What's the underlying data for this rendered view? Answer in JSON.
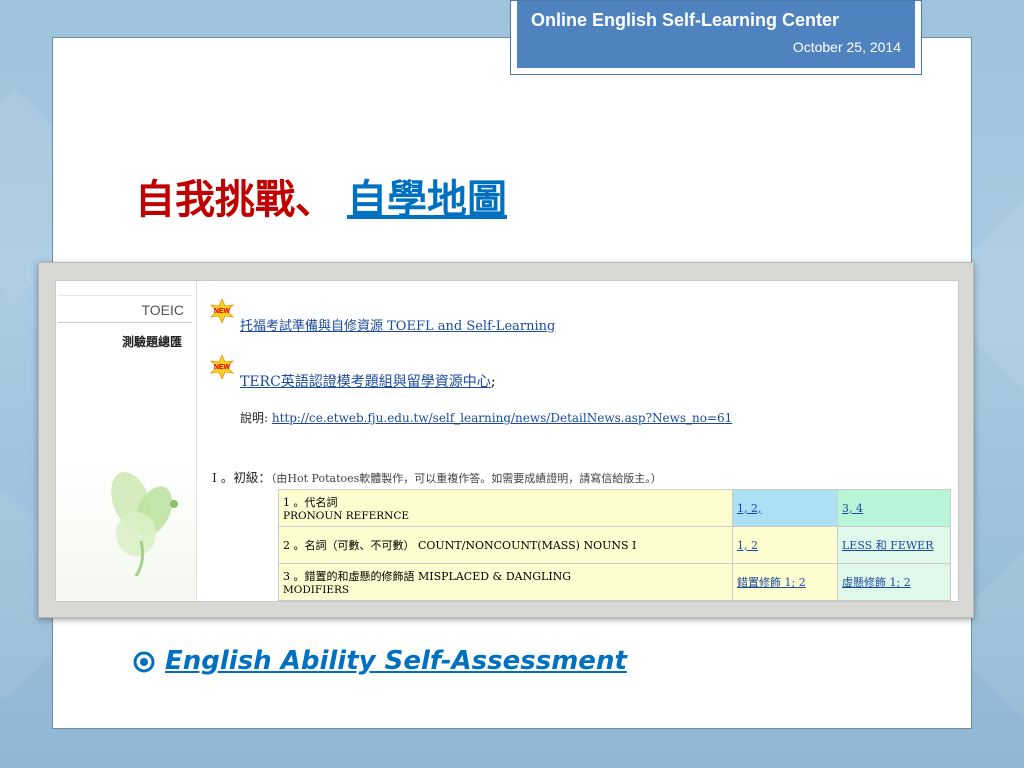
{
  "header": {
    "title": "Online English Self-Learning Center",
    "date": "October 25, 2014"
  },
  "heading": {
    "prefix": "自我挑戰、",
    "link": "自學地圖"
  },
  "screenshot": {
    "sidebar": {
      "tab": "TOEIC",
      "item": "測驗題總匯"
    },
    "links": [
      {
        "badge": "NEW",
        "text": "托福考試準備與自修資源 TOEFL and Self-Learning"
      },
      {
        "badge": "NEW",
        "text": "TERC英語認證模考題組與留學資源中心",
        "suffix": ";"
      }
    ],
    "description": {
      "label": "說明:",
      "url": "http://ce.etweb.fju.edu.tw/self_learning/news/DetailNews.asp?News_no=61"
    },
    "level": {
      "title": "I 。初級：",
      "note": "（由Hot Potatoes軟體製作，可以重複作答。如需要成績證明，請寫信給版主。）"
    },
    "lessons": [
      {
        "title": "1 。代名詞",
        "subtitle": "PRONOUN REFERNCE",
        "col2": "1, 2,",
        "col3": "3, 4"
      },
      {
        "title": "2 。名詞（可數、不可數） COUNT/NONCOUNT(MASS) NOUNS I",
        "subtitle": "",
        "col2": "1, 2",
        "col3": "LESS 和 FEWER"
      },
      {
        "title": "3 。錯置的和虛懸的修飾語 MISPLACED & DANGLING",
        "subtitle": "MODIFIERS",
        "col2": "錯置修飾 1; 2",
        "col3": "虛懸修飾 1; 2"
      }
    ]
  },
  "bullet": {
    "text": "English Ability Self-Assessment"
  },
  "colors": {
    "header_bg": "#4f83c0",
    "heading_red": "#c00000",
    "link_blue": "#0070c0"
  }
}
